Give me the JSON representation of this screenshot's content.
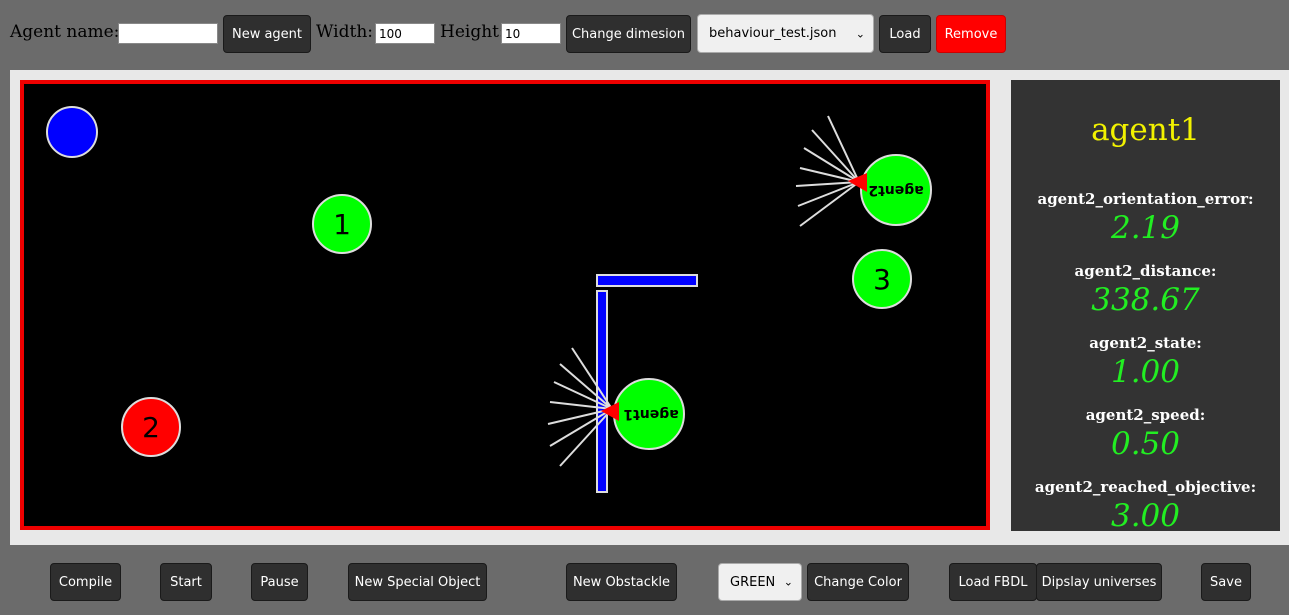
{
  "toolbar": {
    "agent_name_label": "Agent name:",
    "agent_name_value": "",
    "new_agent_label": "New agent",
    "width_label": "Width:",
    "width_value": "100",
    "height_label": "Height:",
    "height_value": "10",
    "change_dimension_label": "Change dimesion",
    "file_select_value": "behaviour_test.json",
    "load_label": "Load",
    "remove_label": "Remove",
    "remove_color": "#ff0000"
  },
  "arena": {
    "border_color": "#ee0000",
    "background": "#000000",
    "objectives": [
      {
        "label": "1",
        "color": "#00ff00"
      },
      {
        "label": "2",
        "color": "#ff0000"
      },
      {
        "label": "3",
        "color": "#00ff00"
      }
    ],
    "agents": [
      {
        "name": "agent1",
        "color": "#00ff00"
      },
      {
        "name": "agent2",
        "color": "#00ff00"
      }
    ],
    "special_object_color": "#0000ff",
    "obstacle_color": "#0000ff"
  },
  "sidebar": {
    "title": "agent1",
    "metrics": [
      {
        "name": "agent2_orientation_error:",
        "value": "2.19"
      },
      {
        "name": "agent2_distance:",
        "value": "338.67"
      },
      {
        "name": "agent2_state:",
        "value": "1.00"
      },
      {
        "name": "agent2_speed:",
        "value": "0.50"
      },
      {
        "name": "agent2_reached_objective:",
        "value": "3.00"
      }
    ]
  },
  "bottombar": {
    "compile_label": "Compile",
    "start_label": "Start",
    "pause_label": "Pause",
    "new_special_object_label": "New Special Object",
    "new_obstacle_label": "New Obstackle",
    "color_select_value": "GREEN",
    "change_color_label": "Change Color",
    "load_fbdl_label": "Load FBDL",
    "display_universes_label": "Dipslay universes",
    "save_label": "Save"
  }
}
